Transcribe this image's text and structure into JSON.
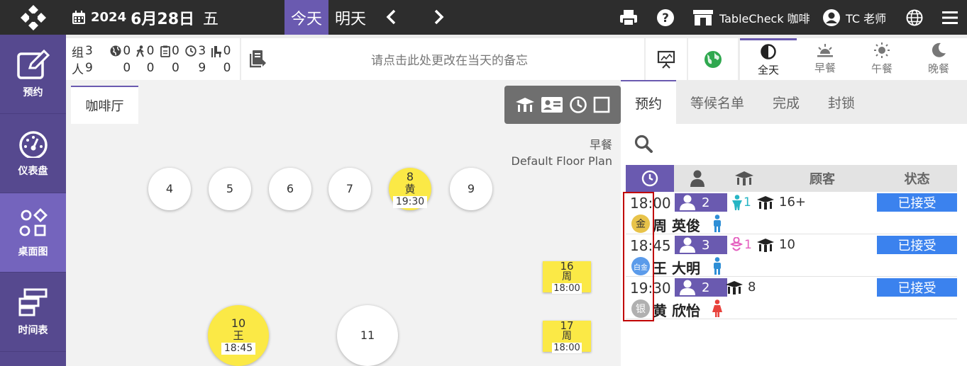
{
  "header": {
    "year": "2024",
    "month_day": "6月28日",
    "weekday": "五",
    "today_label": "今天",
    "tomorrow_label": "明天",
    "venue": "TableCheck 咖啡",
    "user": "TC 老师"
  },
  "sidebar": {
    "items": [
      {
        "label": "预约"
      },
      {
        "label": "仪表盘"
      },
      {
        "label": "桌面图"
      },
      {
        "label": "时间表"
      }
    ]
  },
  "stats": {
    "row1_label": "组",
    "row2_label": "人",
    "groups": [
      "3",
      "0",
      "0",
      "0",
      "3",
      "0"
    ],
    "people": [
      "9",
      "0",
      "0",
      "0",
      "9",
      "0"
    ]
  },
  "memo": {
    "placeholder": "请点击此处更改在当天的备忘"
  },
  "periods": [
    {
      "label": "全天"
    },
    {
      "label": "早餐"
    },
    {
      "label": "午餐"
    },
    {
      "label": "晚餐"
    }
  ],
  "floor": {
    "tab": "咖啡厅",
    "meal": "早餐",
    "plan": "Default Floor Plan",
    "tables": [
      {
        "num": "4"
      },
      {
        "num": "5"
      },
      {
        "num": "6"
      },
      {
        "num": "7"
      },
      {
        "num": "8",
        "guest": "黄",
        "time": "19:30"
      },
      {
        "num": "9"
      },
      {
        "num": "10",
        "guest": "王",
        "time": "18:45"
      },
      {
        "num": "11"
      },
      {
        "num": "16",
        "guest": "周",
        "time": "18:00"
      },
      {
        "num": "17",
        "guest": "周",
        "time": "18:00"
      }
    ]
  },
  "right_panel": {
    "tabs": [
      "预约",
      "等候名单",
      "完成",
      "封锁"
    ],
    "headers": {
      "customer": "顾客",
      "status": "状态"
    },
    "reservations": [
      {
        "time": "18:00",
        "party": "2",
        "kids": "1",
        "seat": "16+",
        "status": "已接受",
        "tier": "金",
        "surname": "周",
        "given": "英俊"
      },
      {
        "time": "18:45",
        "party": "3",
        "kids": "1",
        "seat": "10",
        "status": "已接受",
        "tier": "白金",
        "surname": "王",
        "given": "大明"
      },
      {
        "time": "19:30",
        "party": "2",
        "kids": "",
        "seat": "8",
        "status": "已接受",
        "tier": "银",
        "surname": "黄",
        "given": "欣怡"
      }
    ]
  },
  "colors": {
    "accent": "#6a5ab0",
    "sidebar": "#56498f",
    "status_blue": "#3b82ee",
    "table_yellow": "#fbe946",
    "tier_gold": "#e8c34a",
    "tier_platinum": "#5b9bea",
    "tier_silver": "#b0b0b0",
    "highlight": "#c00000"
  }
}
